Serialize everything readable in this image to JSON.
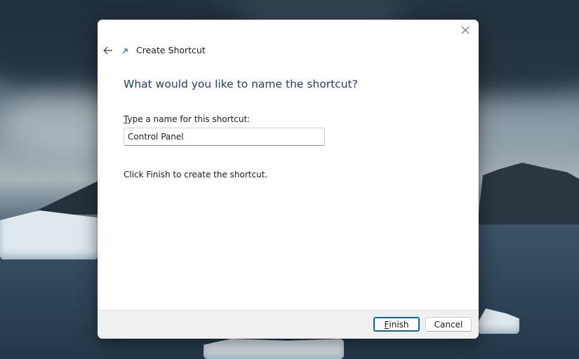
{
  "wizard": {
    "title": "Create Shortcut",
    "heading": "What would you like to name the shortcut?",
    "name_label_access_key": "T",
    "name_label_rest": "ype a name for this shortcut:",
    "name_value": "Control Panel",
    "info_text": "Click Finish to create the shortcut."
  },
  "buttons": {
    "finish_access_key": "F",
    "finish_rest": "inish",
    "cancel": "Cancel"
  },
  "icons": {
    "close": "close-icon",
    "back": "back-arrow-icon",
    "wizard": "shortcut-arrow-icon"
  },
  "colors": {
    "heading": "#1f3d7a",
    "default_button_border": "#0067c0",
    "footer_bg": "#f0f0f0"
  }
}
